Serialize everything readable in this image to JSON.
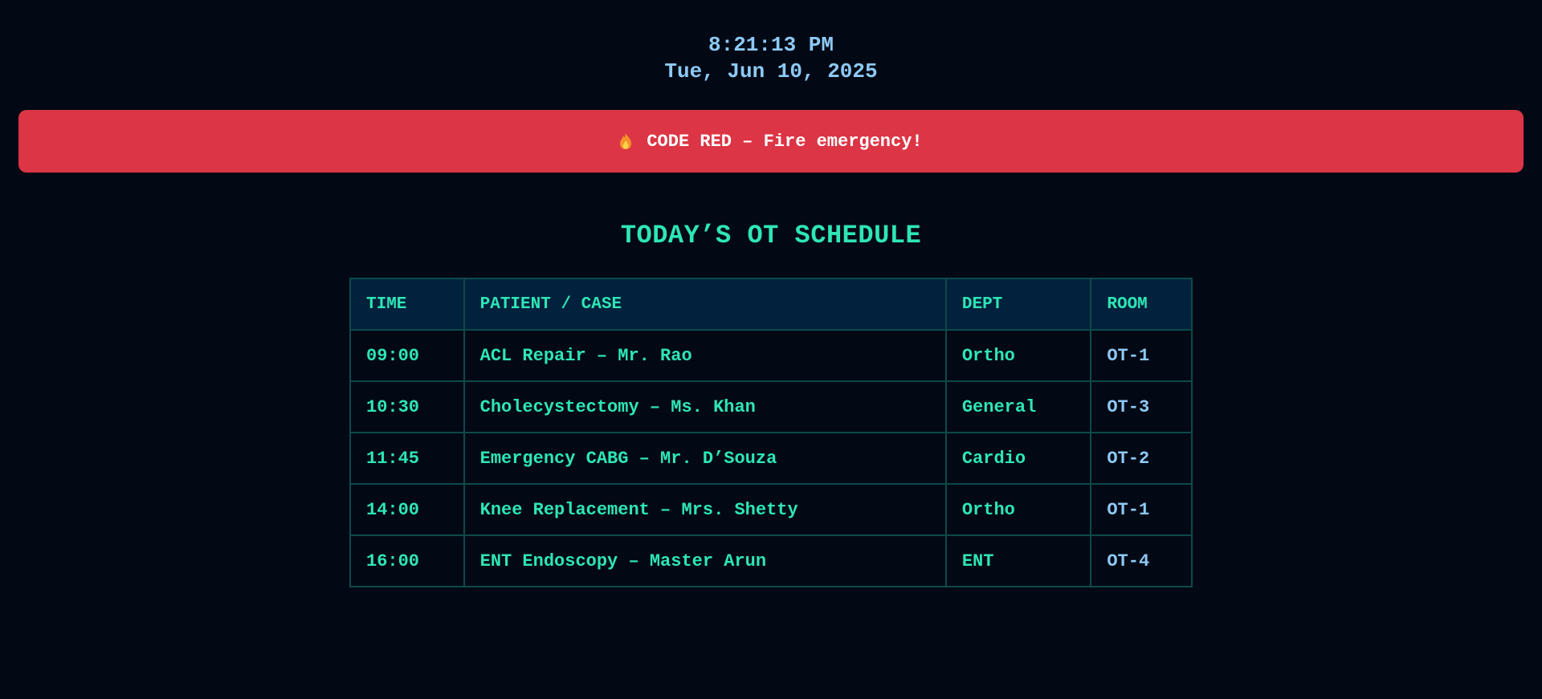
{
  "clock": {
    "time": "8:21:13 PM",
    "date": "Tue, Jun 10, 2025"
  },
  "alert": {
    "icon": "flame-icon",
    "text": "CODE RED – Fire emergency!",
    "color": "#dc3545"
  },
  "schedule": {
    "title": "TODAY’S OT SCHEDULE",
    "headers": {
      "time": "TIME",
      "case": "PATIENT / CASE",
      "dept": "DEPT",
      "room": "ROOM"
    },
    "rows": [
      {
        "time": "09:00",
        "case": "ACL Repair – Mr. Rao",
        "dept": "Ortho",
        "room": "OT-1"
      },
      {
        "time": "10:30",
        "case": "Cholecystectomy – Ms. Khan",
        "dept": "General",
        "room": "OT-3"
      },
      {
        "time": "11:45",
        "case": "Emergency CABG – Mr. D’Souza",
        "dept": "Cardio",
        "room": "OT-2"
      },
      {
        "time": "14:00",
        "case": "Knee Replacement – Mrs. Shetty",
        "dept": "Ortho",
        "room": "OT-1"
      },
      {
        "time": "16:00",
        "case": "ENT Endoscopy – Master Arun",
        "dept": "ENT",
        "room": "OT-4"
      }
    ]
  },
  "colors": {
    "background": "#020915",
    "accent": "#2ee6b6",
    "clock": "#8ec9f5",
    "alert": "#dc3545"
  }
}
